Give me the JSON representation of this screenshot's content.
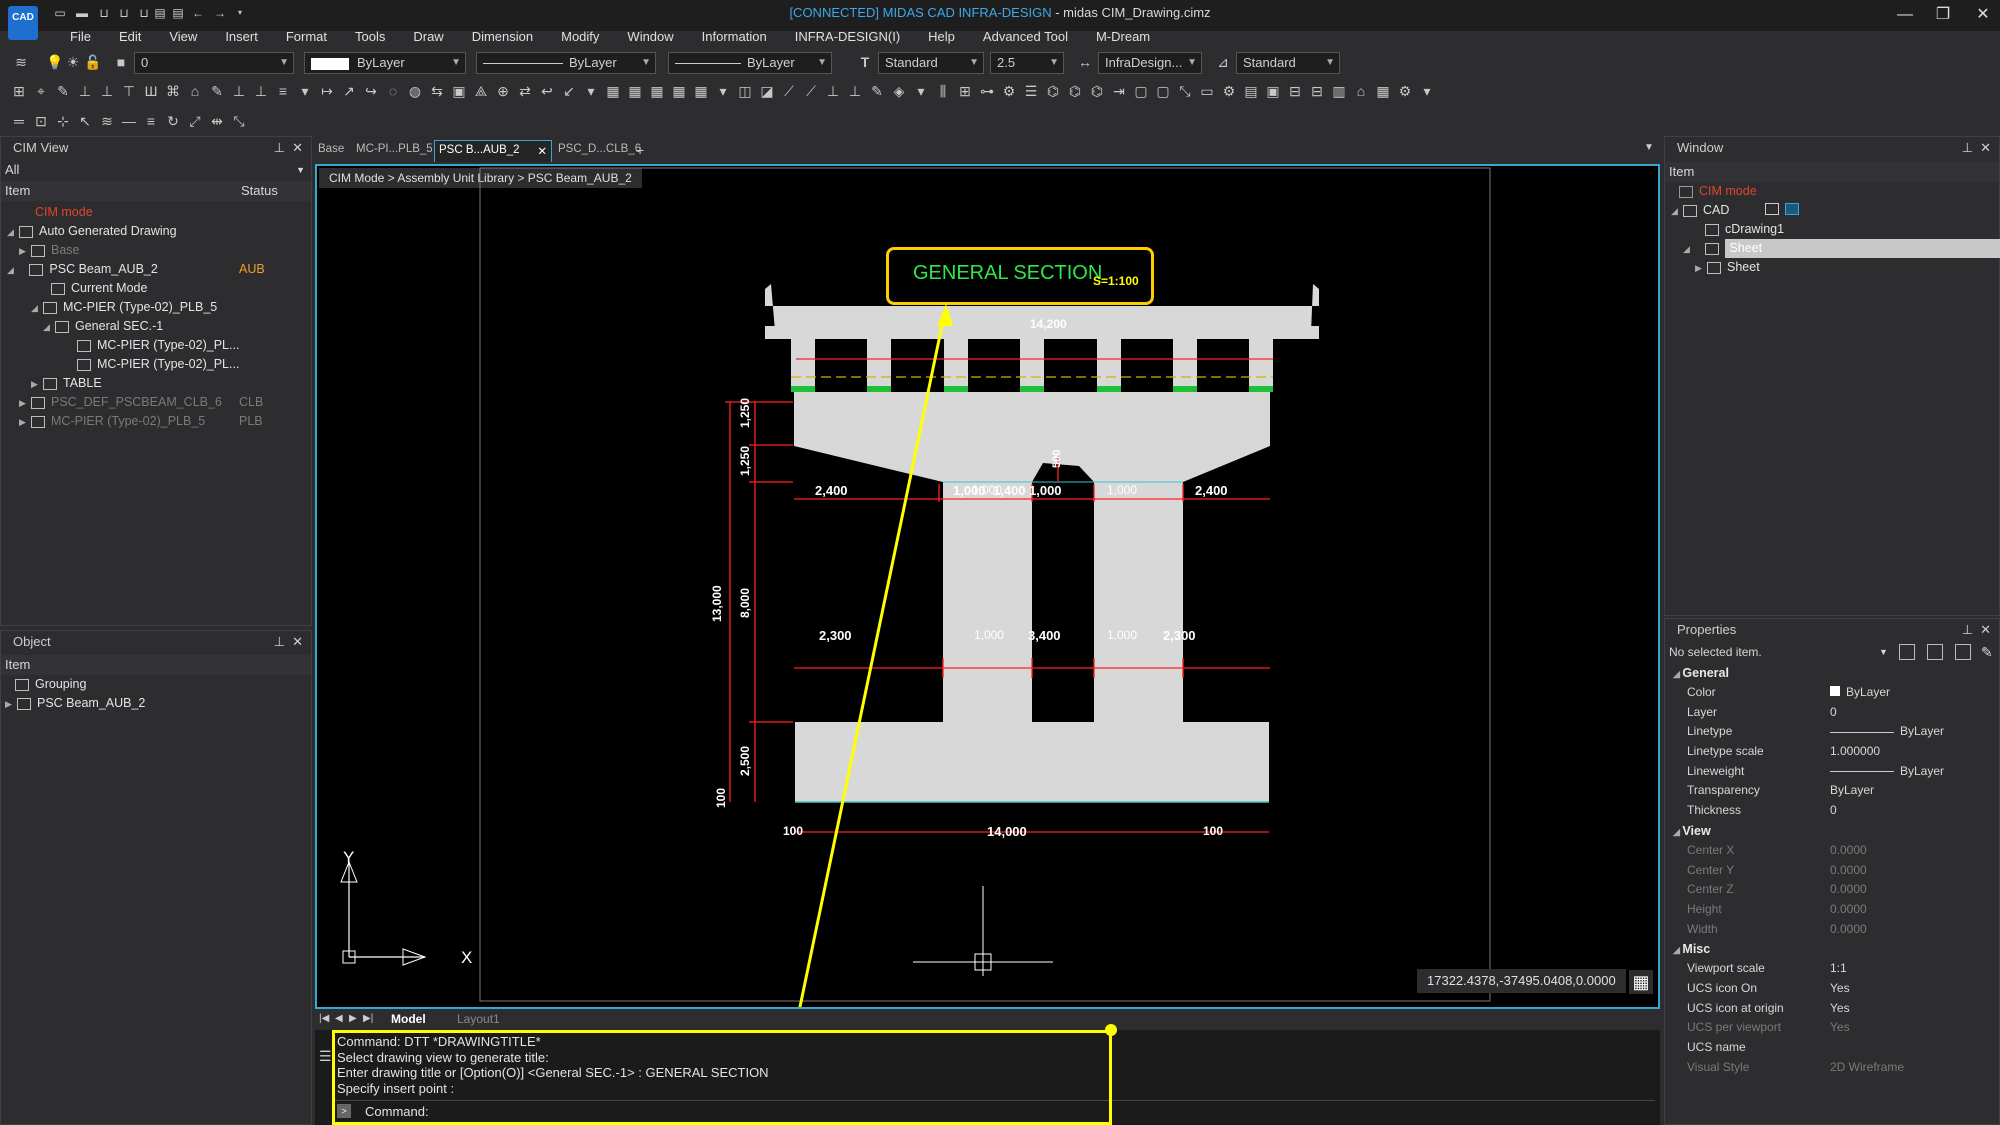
{
  "app": {
    "logo": "CAD",
    "title_connected": "[CONNECTED] MIDAS CAD INFRA-DESIGN",
    "title_rest": " - midas CIM_Drawing.cimz",
    "minimize": "—",
    "maximize": "❐",
    "close": "✕"
  },
  "menu": [
    "File",
    "Edit",
    "View",
    "Insert",
    "Format",
    "Tools",
    "Draw",
    "Dimension",
    "Modify",
    "Window",
    "Information",
    "INFRA-DESIGN(I)",
    "Help",
    "Advanced Tool",
    "M-Dream"
  ],
  "toolbar": {
    "layer_value": "0",
    "color_value": "ByLayer",
    "linetype_value": "ByLayer",
    "lineweight_value": "ByLayer",
    "textstyle_value": "Standard",
    "textheight_value": "2.5",
    "dimstyle_value": "InfraDesign...",
    "tablestyle_value": "Standard"
  },
  "cim_view": {
    "title": "CIM View",
    "filter": "All",
    "col_item": "Item",
    "col_status": "Status",
    "rows": [
      {
        "label": "CIM mode",
        "status": ""
      },
      {
        "label": "Auto Generated Drawing",
        "status": ""
      },
      {
        "label": "Base",
        "status": ""
      },
      {
        "label": "PSC Beam_AUB_2",
        "status": "AUB"
      },
      {
        "label": "Current Mode",
        "status": ""
      },
      {
        "label": "MC-PIER (Type-02)_PLB_5",
        "status": ""
      },
      {
        "label": "General SEC.-1",
        "status": ""
      },
      {
        "label": "MC-PIER (Type-02)_PL...",
        "status": ""
      },
      {
        "label": "MC-PIER (Type-02)_PL...",
        "status": ""
      },
      {
        "label": "TABLE",
        "status": ""
      },
      {
        "label": "PSC_DEF_PSCBEAM_CLB_6",
        "status": "CLB"
      },
      {
        "label": "MC-PIER (Type-02)_PLB_5",
        "status": "PLB"
      }
    ]
  },
  "object_panel": {
    "title": "Object",
    "col_item": "Item",
    "rows": [
      "Grouping",
      "PSC Beam_AUB_2"
    ]
  },
  "doc_tabs": [
    "Base",
    "MC-PI...PLB_5",
    "PSC B...AUB_2",
    "PSC_D...CLB_6",
    "+"
  ],
  "breadcrumb": "CIM Mode > Assembly Unit Library > PSC Beam_AUB_2",
  "drawing": {
    "title": "GENERAL SECTION",
    "scale": "S=1:100",
    "dims": {
      "top_width": "14,200",
      "d2400a": "2,400",
      "d1000a": "1,000",
      "d1000b": "1,000",
      "d1400": "1,400",
      "d1000c": "1,000",
      "d1000d": "1,000",
      "d2400b": "2,400",
      "d500": "500",
      "d2300a": "2,300",
      "d1000e": "1,000",
      "d3400": "3,400",
      "d1000f": "1,000",
      "d2300b": "2,300",
      "d100a": "100",
      "d14000": "14,000",
      "d100b": "100",
      "v1250a": "1,250",
      "v1250b": "1,250",
      "v8000": "8,000",
      "v13000": "13,000",
      "v2500": "2,500",
      "v100": "100"
    }
  },
  "ucs": {
    "y": "Y",
    "x": "X"
  },
  "coords": "17322.4378,-37495.0408,0.0000",
  "layout_tabs": [
    "Model",
    "Layout1"
  ],
  "command": {
    "lines": [
      "Command:  DTT *DRAWINGTITLE*",
      "Select drawing view to generate title:",
      "Enter drawing title or [Option(O)] <General SEC.-1> : GENERAL SECTION",
      "Specify insert point :"
    ],
    "prompt": "Command:"
  },
  "window_panel": {
    "title": "Window",
    "col_item": "Item",
    "rows": [
      "CIM mode",
      "CAD",
      "cDrawing1",
      "Sheet",
      "Sheet"
    ]
  },
  "properties": {
    "title": "Properties",
    "selection": "No selected item.",
    "sections": [
      {
        "name": "General",
        "items": [
          [
            "Color",
            "ByLayer"
          ],
          [
            "Layer",
            "0"
          ],
          [
            "Linetype",
            "ByLayer"
          ],
          [
            "Linetype scale",
            "1.000000"
          ],
          [
            "Lineweight",
            "ByLayer"
          ],
          [
            "Transparency",
            "ByLayer"
          ],
          [
            "Thickness",
            "0"
          ]
        ]
      },
      {
        "name": "View",
        "items": [
          [
            "Center X",
            "0.0000"
          ],
          [
            "Center Y",
            "0.0000"
          ],
          [
            "Center Z",
            "0.0000"
          ],
          [
            "Height",
            "0.0000"
          ],
          [
            "Width",
            "0.0000"
          ]
        ]
      },
      {
        "name": "Misc",
        "items": [
          [
            "Viewport scale",
            "1:1"
          ],
          [
            "UCS icon On",
            "Yes"
          ],
          [
            "UCS icon at origin",
            "Yes"
          ],
          [
            "UCS per viewport",
            "Yes"
          ],
          [
            "UCS name",
            ""
          ],
          [
            "Visual Style",
            "2D Wireframe"
          ]
        ]
      }
    ]
  },
  "colors": {
    "accent": "#37a6d2",
    "highlight_yellow": "#ffff00",
    "dim_red": "#ff2020",
    "title_green": "#2ee84a",
    "concrete": "#d8d8d8"
  }
}
